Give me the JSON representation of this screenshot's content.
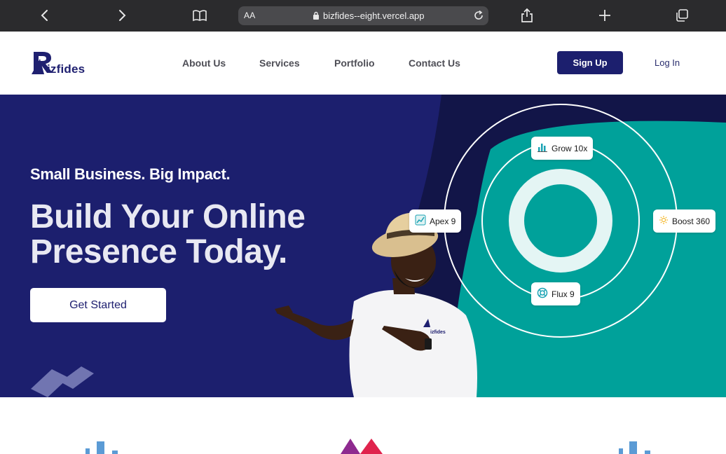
{
  "browser": {
    "text_size_label": "AA",
    "url": "bizfides--eight.vercel.app",
    "icons": [
      "back-icon",
      "forward-icon",
      "bookmarks-icon",
      "lock-icon",
      "reload-icon",
      "share-icon",
      "new-tab-icon",
      "tabs-icon"
    ]
  },
  "header": {
    "logo_text": "izfides",
    "nav": [
      "About Us",
      "Services",
      "Portfolio",
      "Contact Us"
    ],
    "signup_label": "Sign Up",
    "login_label": "Log In"
  },
  "hero": {
    "tagline": "Small Business. Big Impact.",
    "headline_line1": "Build Your Online",
    "headline_line2": "Presence Today.",
    "cta_label": "Get Started",
    "shirt_logo": "izfides",
    "chips": {
      "top": "Grow 10x",
      "left": "Apex 9",
      "right": "Boost 360",
      "bottom": "Flux 9"
    }
  },
  "colors": {
    "brand_navy": "#1c1f6e",
    "deep_navy": "#121548",
    "teal": "#00a19a",
    "ring_light": "#e4f5f4",
    "chrome_bg": "#2b2b2d"
  }
}
